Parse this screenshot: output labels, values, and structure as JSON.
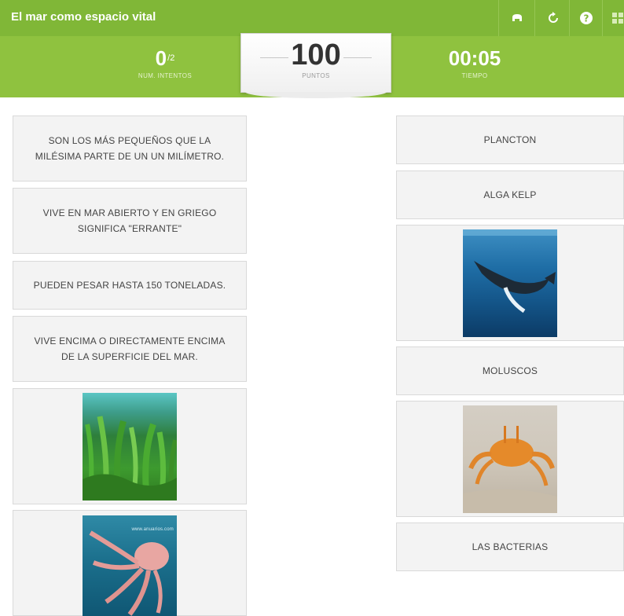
{
  "header": {
    "title": "El mar como espacio vital",
    "icons": [
      "gamepad-icon",
      "restart-icon",
      "help-icon",
      "grid-icon"
    ]
  },
  "score": {
    "attempts_value": "0",
    "attempts_total": "/2",
    "attempts_label": "NUM. INTENTOS",
    "points_value": "100",
    "points_label": "PUNTOS",
    "time_value": "00:05",
    "time_label": "TIEMPO"
  },
  "left_cards": [
    "SON LOS MÁS PEQUEÑOS QUE LA MILÉSIMA PARTE DE UN UN MILÍMETRO.",
    "VIVE EN MAR ABIERTO Y EN GRIEGO SIGNIFICA \"ERRANTE\"",
    "PUEDEN PESAR HASTA 150 TONELADAS.",
    "VIVE ENCIMA O DIRECTAMENTE ENCIMA DE LA SUPERFICIE DEL MAR."
  ],
  "right_cards": {
    "plancton": "PLANCTON",
    "alga_kelp": "ALGA KELP",
    "moluscos": "MOLUSCOS",
    "las_bacterias": "LAS BACTERIAS"
  },
  "image_watermark": "www.anuarios.com",
  "colors": {
    "top_bar": "#80b737",
    "score_bar": "#8fc23f",
    "card_bg": "#f3f3f3",
    "card_border": "#d9d9d9"
  }
}
